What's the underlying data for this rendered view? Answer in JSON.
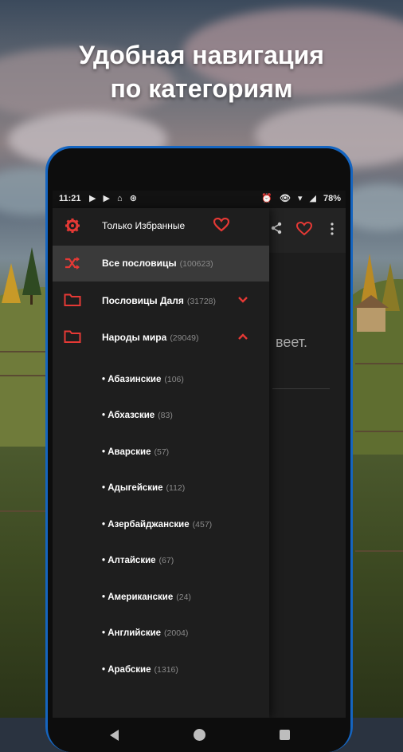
{
  "headline": {
    "line1": "Удобная навигация",
    "line2": "по категориям"
  },
  "status_bar": {
    "time": "11:21",
    "left_icons": "▶ ▶ ⌂ ⊛",
    "right_icons": "⏰ 👁 ▾ ◢",
    "battery": "78%"
  },
  "app": {
    "partial_text": "веет."
  },
  "drawer": {
    "favorites_label": "Только Избранные",
    "all_label": "Все пословицы",
    "all_count": "(100623)",
    "dal_label": "Пословицы Даля",
    "dal_count": "(31728)",
    "peoples_label": "Народы мира",
    "peoples_count": "(29049)",
    "subcategories": [
      {
        "label": "• Абазинские",
        "count": "(106)"
      },
      {
        "label": "• Абхазские",
        "count": "(83)"
      },
      {
        "label": "• Аварские",
        "count": "(57)"
      },
      {
        "label": "• Адыгейские",
        "count": "(112)"
      },
      {
        "label": "• Азербайджанские",
        "count": "(457)"
      },
      {
        "label": "• Алтайские",
        "count": "(67)"
      },
      {
        "label": "• Американские",
        "count": "(24)"
      },
      {
        "label": "• Английские",
        "count": "(2004)"
      },
      {
        "label": "• Арабские",
        "count": "(1316)"
      }
    ]
  },
  "colors": {
    "accent": "#e53935",
    "drawer_bg": "#1e1e1e",
    "selected_bg": "#3a3a3a",
    "phone_frame": "#1565c0"
  },
  "icons": [
    "gear-icon",
    "heart-icon",
    "shuffle-icon",
    "folder-icon",
    "chevron-down-icon",
    "chevron-up-icon",
    "share-icon",
    "more-vert-icon",
    "back-icon",
    "home-icon",
    "recents-icon"
  ]
}
